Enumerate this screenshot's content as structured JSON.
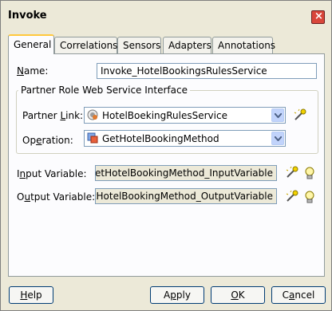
{
  "window": {
    "title": "Invoke"
  },
  "tabs": [
    {
      "label": "General",
      "u": "",
      "active": true
    },
    {
      "label": "Correlations"
    },
    {
      "label": "Sensors"
    },
    {
      "label": "Adapters"
    },
    {
      "label": "Annotations"
    }
  ],
  "general": {
    "name_label_u": "N",
    "name_label_rest": "ame:",
    "name_value": "Invoke_HotelBookingsRulesService",
    "group_title": "Partner Role Web Service Interface",
    "partner_link_label_a": "Partner ",
    "partner_link_label_u": "L",
    "partner_link_label_b": "ink:",
    "partner_link_value": "HotelBoekingRulesService",
    "operation_label_a": "Op",
    "operation_label_u": "e",
    "operation_label_b": "ration:",
    "operation_value": "GetHotelBookingMethod",
    "input_label_a": "I",
    "input_label_u": "n",
    "input_label_b": "put Variable:",
    "input_value": "GetHotelBookingMethod_InputVariable",
    "output_label_a": "O",
    "output_label_u": "u",
    "output_label_b": "tput Variable:",
    "output_value": "GetHotelBookingMethod_OutputVariable"
  },
  "buttons": {
    "help_u": "H",
    "help_rest": "elp",
    "apply_a": "A",
    "apply_u": "p",
    "apply_b": "ply",
    "ok_u": "O",
    "ok_rest": "K",
    "cancel_a": "C",
    "cancel_u": "a",
    "cancel_b": "ncel"
  },
  "icons": {
    "close": "close-icon",
    "partner_link": "service-icon",
    "operation": "operation-icon",
    "browse": "browse-wand-icon",
    "create": "create-lightbulb-icon"
  }
}
